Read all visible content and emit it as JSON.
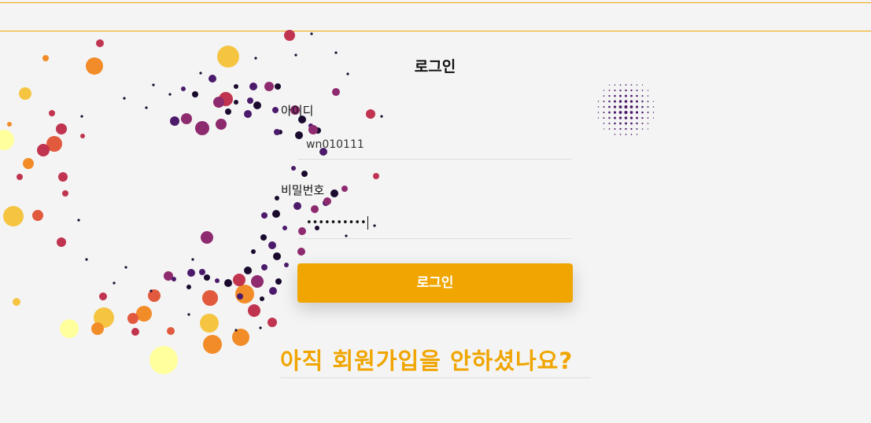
{
  "login": {
    "title": "로그인",
    "id_label": "아이디",
    "id_value": "wn010111",
    "password_label": "비밀번호",
    "password_value": "••••••••••",
    "submit_label": "로그인"
  },
  "signup_prompt": "아직 회원가입을 안하셨나요?",
  "colors": {
    "accent": "#f0a500",
    "background": "#f4f4f4",
    "particles": [
      "#f5c542",
      "#f28c28",
      "#e15a3d",
      "#c0344f",
      "#8e2a6e",
      "#4b1a6b",
      "#1a0a2e",
      "#ffff9e"
    ]
  }
}
